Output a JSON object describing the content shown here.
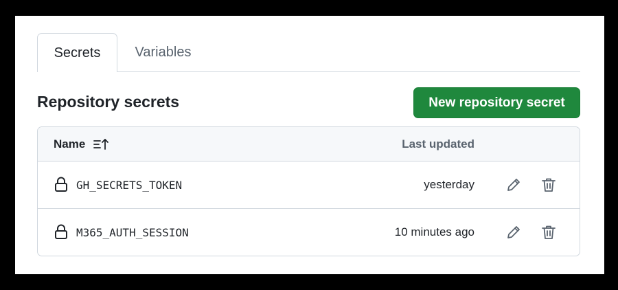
{
  "tabs": [
    {
      "label": "Secrets",
      "active": true
    },
    {
      "label": "Variables",
      "active": false
    }
  ],
  "section": {
    "title": "Repository secrets",
    "new_button_label": "New repository secret"
  },
  "table": {
    "columns": {
      "name": "Name",
      "last_updated": "Last updated"
    },
    "rows": [
      {
        "name": "GH_SECRETS_TOKEN",
        "last_updated": "yesterday"
      },
      {
        "name": "M365_AUTH_SESSION",
        "last_updated": "10 minutes ago"
      }
    ]
  },
  "icons": {
    "sort": "sort-ascending-icon",
    "lock": "lock-icon",
    "edit": "pencil-icon",
    "delete": "trash-icon"
  },
  "colors": {
    "primary_button": "#1f883d",
    "border": "#d0d7de",
    "header_bg": "#f6f8fa",
    "muted_text": "#59636e",
    "page_background": "#000000",
    "card_background": "#ffffff"
  }
}
